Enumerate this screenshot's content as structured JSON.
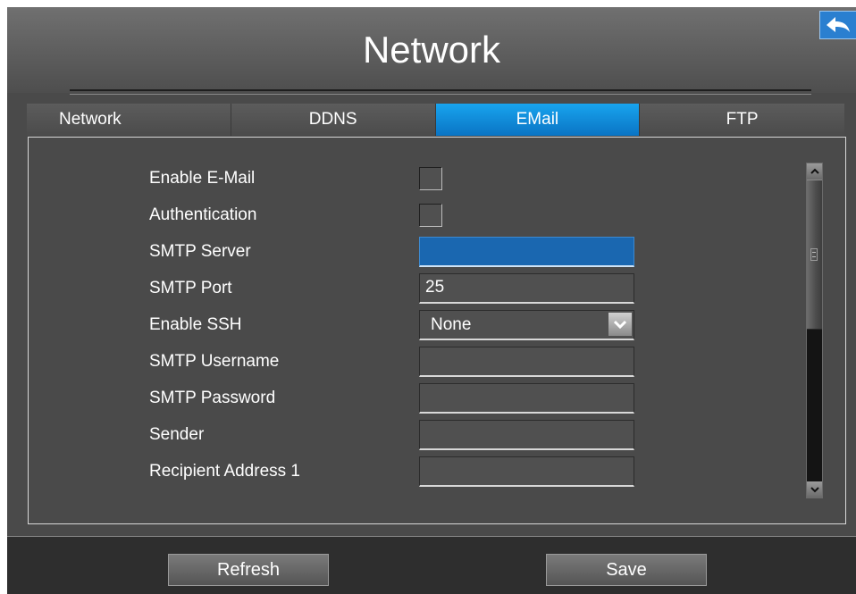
{
  "window": {
    "title": "Network",
    "back_icon": "back-arrow-icon"
  },
  "tabs": [
    {
      "label": "Network",
      "active": false
    },
    {
      "label": "DDNS",
      "active": false
    },
    {
      "label": "EMail",
      "active": true
    },
    {
      "label": "FTP",
      "active": false
    }
  ],
  "form": {
    "enable_email": {
      "label": "Enable E-Mail",
      "checked": false
    },
    "authentication": {
      "label": "Authentication",
      "checked": false
    },
    "smtp_server": {
      "label": "SMTP Server",
      "value": ""
    },
    "smtp_port": {
      "label": "SMTP Port",
      "value": "25"
    },
    "enable_ssh": {
      "label": "Enable SSH",
      "value": "None"
    },
    "smtp_username": {
      "label": "SMTP Username",
      "value": ""
    },
    "smtp_password": {
      "label": "SMTP Password",
      "value": ""
    },
    "sender": {
      "label": "Sender",
      "value": ""
    },
    "recipient_1": {
      "label": "Recipient Address 1",
      "value": ""
    }
  },
  "scroll": {
    "position": 0
  },
  "footer": {
    "refresh_label": "Refresh",
    "save_label": "Save"
  },
  "colors": {
    "accent": "#0a8ee0",
    "focused_field": "#1a67b0",
    "background": "#4a4a4a",
    "footer": "#2e2e2e"
  }
}
